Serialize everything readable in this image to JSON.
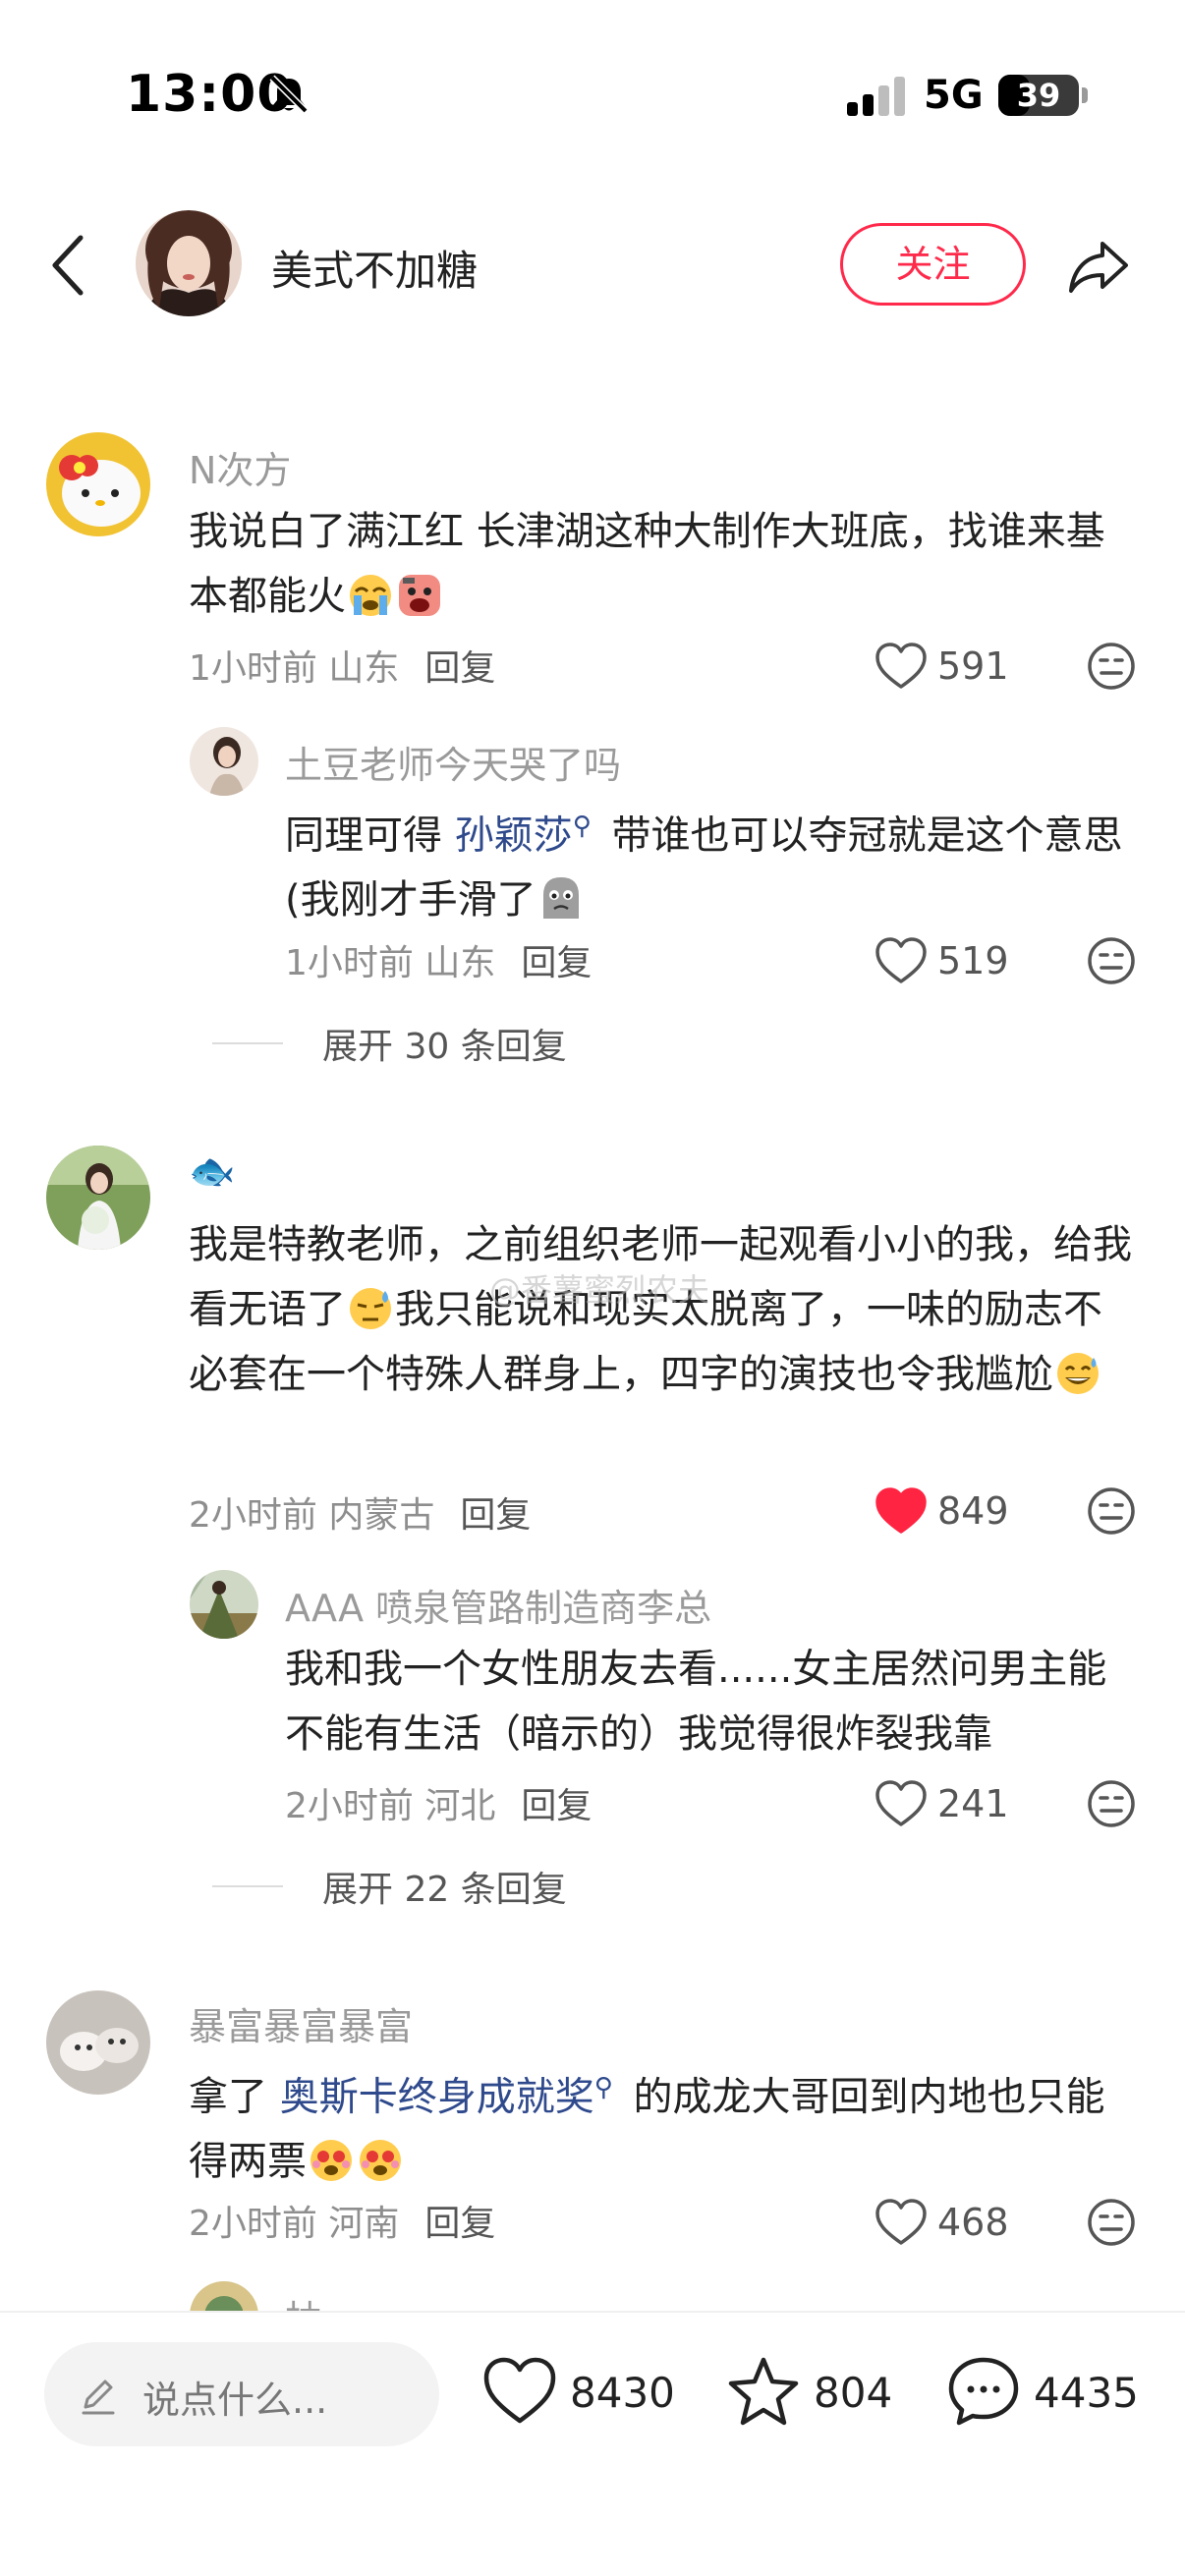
{
  "status_bar": {
    "time": "13:00",
    "network": "5G",
    "battery": "39",
    "battery_level": 0.39
  },
  "header": {
    "username": "美式不加糖",
    "follow_label": "关注"
  },
  "comments": [
    {
      "name": "N次方",
      "text": "我说白了满江红 长津湖这种大制作大班底，找谁来基本都能火",
      "time": "1小时前",
      "location": "山东",
      "reply_label": "回复",
      "likes": "591",
      "replies": [
        {
          "name": "土豆老师今天哭了吗",
          "text_before": "同理可得 ",
          "link": "孙颖莎",
          "text_after": " 带谁也可以夺冠就是这个意思 (我刚才手滑了",
          "time": "1小时前",
          "location": "山东",
          "reply_label": "回复",
          "likes": "519"
        }
      ],
      "expand_label": "展开 30 条回复"
    },
    {
      "name": "🐟",
      "text_before": "我是特教老师，之前组织老师一起观看小小的我，给我看无语了",
      "text_after": "我只能说和现实太脱离了，一味的励志不必套在一个特殊人群身上，四字的演技也令我尴尬",
      "time": "2小时前",
      "location": "内蒙古",
      "reply_label": "回复",
      "likes": "849",
      "replies": [
        {
          "name": "AAA 喷泉管路制造商李总",
          "text": "我和我一个女性朋友去看......女主居然问男主能不能有生活（暗示的）我觉得很炸裂我靠",
          "time": "2小时前",
          "location": "河北",
          "reply_label": "回复",
          "likes": "241"
        }
      ],
      "expand_label": "展开 22 条回复"
    },
    {
      "name": "暴富暴富暴富",
      "text_before": "拿了 ",
      "link": "奥斯卡终身成就奖",
      "text_after": " 的成龙大哥回到内地也只能得两票",
      "time": "2小时前",
      "location": "河南",
      "reply_label": "回复",
      "likes": "468"
    }
  ],
  "next_comment_name": "柚",
  "watermark": "@番薯蜜烈农夫",
  "bottom_bar": {
    "input_placeholder": "说点什么...",
    "likes": "8430",
    "favorites": "804",
    "comments": "4435"
  },
  "colors": {
    "accent": "#ff2a4b",
    "link": "#2f4a8c",
    "muted": "#9a9a9a",
    "liked": "#ff2442"
  },
  "icons": [
    "back-icon",
    "share-icon",
    "heart-icon",
    "dislike-icon",
    "star-icon",
    "chat-icon",
    "pen-icon",
    "bell-slash-icon",
    "signal-icon"
  ]
}
